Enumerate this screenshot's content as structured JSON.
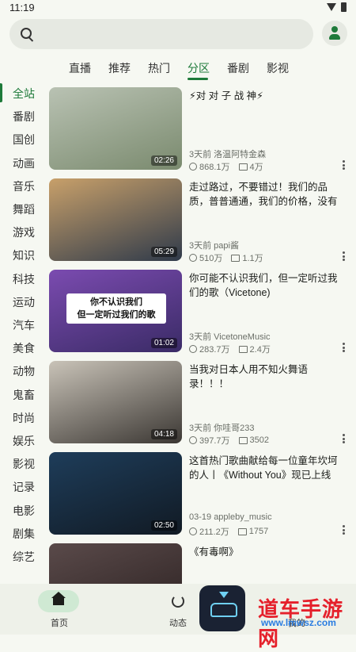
{
  "status": {
    "time": "11:19"
  },
  "search": {
    "placeholder": ""
  },
  "tabs": [
    "直播",
    "推荐",
    "热门",
    "分区",
    "番剧",
    "影视"
  ],
  "active_tab": "分区",
  "categories": [
    "全站",
    "番剧",
    "国创",
    "动画",
    "音乐",
    "舞蹈",
    "游戏",
    "知识",
    "科技",
    "运动",
    "汽车",
    "美食",
    "动物",
    "鬼畜",
    "时尚",
    "娱乐",
    "影视",
    "记录",
    "电影",
    "剧集",
    "综艺"
  ],
  "active_category": "全站",
  "videos": [
    {
      "title": "⚡对 对 子 战 神⚡",
      "duration": "02:26",
      "meta": "3天前  洛温阿特金森",
      "views": "868.1万",
      "danmaku": "4万",
      "thumb_colors": [
        "#b9c2b3",
        "#7a8a6e"
      ]
    },
    {
      "title": "走过路过，不要错过！我们的品质，普普通通，我们的价格，没有极限…",
      "duration": "05:29",
      "meta": "3天前  papi酱",
      "views": "510万",
      "danmaku": "1.1万",
      "thumb_colors": [
        "#c8a06a",
        "#2f3a4a"
      ]
    },
    {
      "title": "你可能不认识我们，但一定听过我们的歌（Vicetone)",
      "duration": "01:02",
      "meta": "3天前  VicetoneMusic",
      "views": "283.7万",
      "danmaku": "2.4万",
      "thumb_colors": [
        "#7b4bb0",
        "#3a2b66"
      ],
      "thumb_caption": "你不认识我们\n但一定听过我们的歌"
    },
    {
      "title": "当我对日本人用不知火舞语录！！！",
      "duration": "04:18",
      "meta": "3天前  你哇哥233",
      "views": "397.7万",
      "danmaku": "3502",
      "thumb_colors": [
        "#c9c3b8",
        "#3b3733"
      ]
    },
    {
      "title": "这首热门歌曲献给每一位童年坎坷的人丨《Without You》现已上线",
      "duration": "02:50",
      "meta": "03-19  appleby_music",
      "views": "211.2万",
      "danmaku": "1757",
      "thumb_colors": [
        "#1e3d5a",
        "#111a24"
      ]
    },
    {
      "title": "《有毒啊》",
      "duration": "",
      "meta": "",
      "views": "",
      "danmaku": "",
      "thumb_colors": [
        "#5a4a4a",
        "#2a2020"
      ]
    }
  ],
  "bottom_nav": {
    "home": "首页",
    "dynamic": "动态",
    "mine": "我的"
  },
  "watermark": {
    "text": "道车手游网",
    "url": "www.lmwsz.com"
  }
}
